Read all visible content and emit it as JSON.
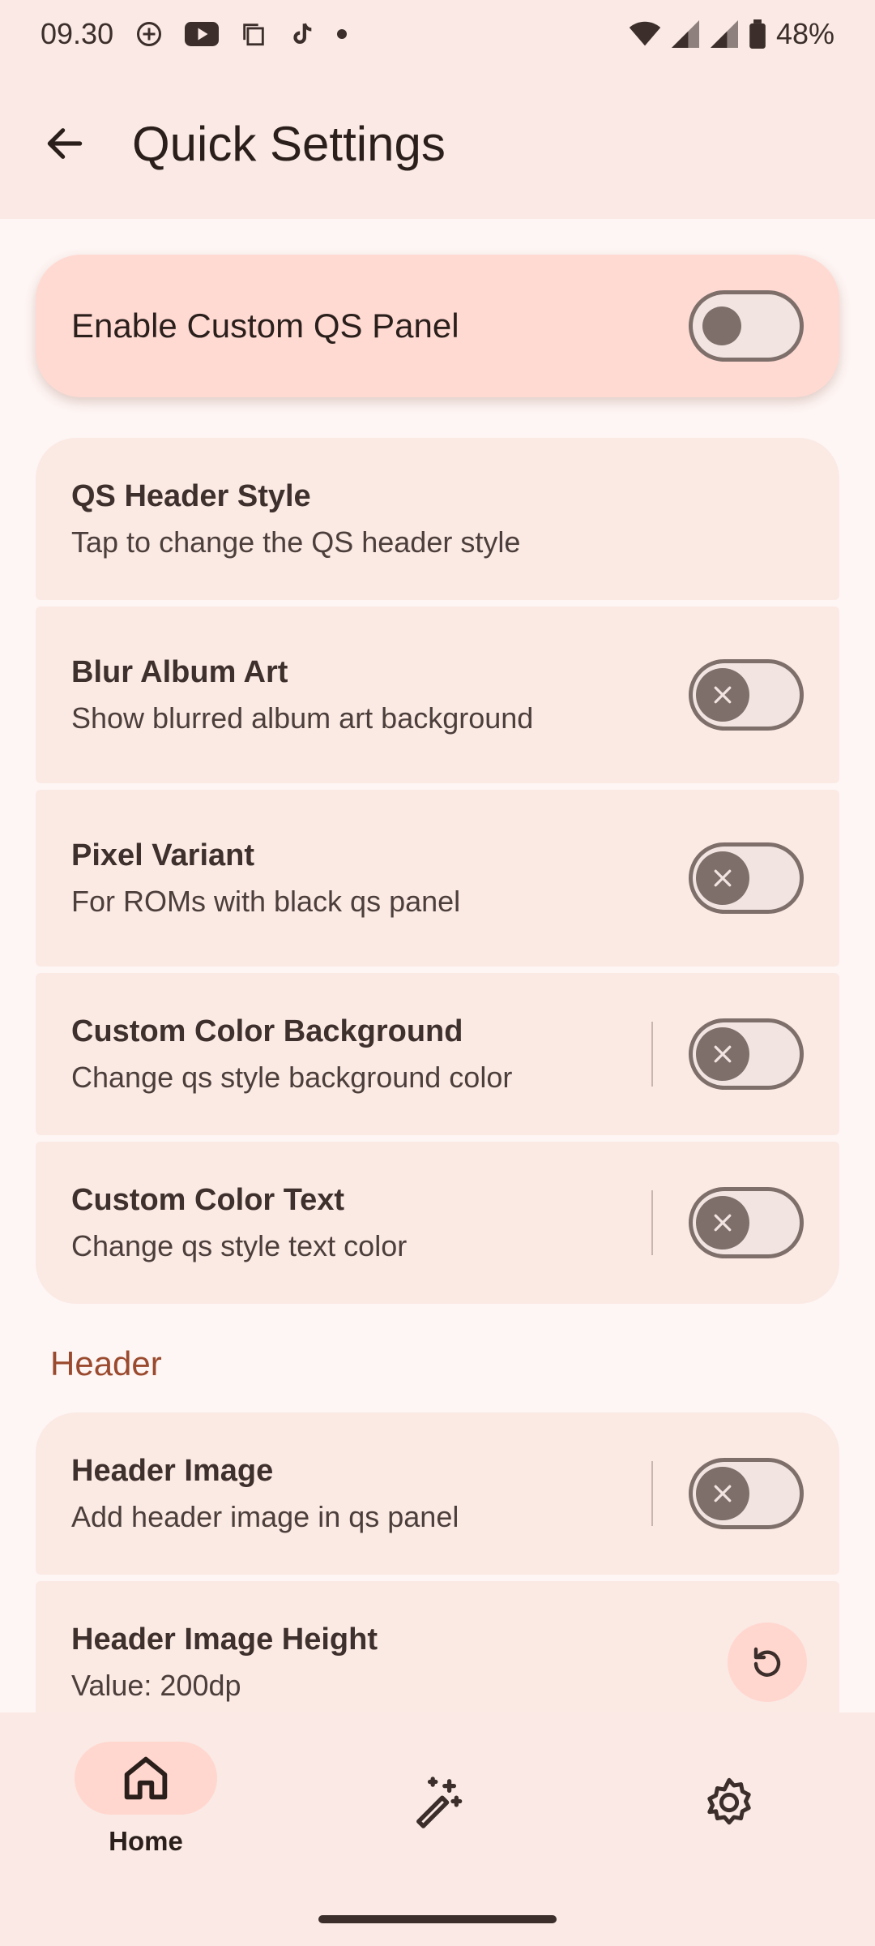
{
  "status_bar": {
    "time": "09.30",
    "battery": "48%",
    "left_icons": [
      "assistant-icon",
      "youtube-icon",
      "copy-icon",
      "tiktok-icon",
      "dot-icon"
    ],
    "right_icons": [
      "wifi-icon",
      "signal-icon",
      "signal-icon",
      "battery-icon"
    ]
  },
  "app_bar": {
    "title": "Quick Settings",
    "back_icon": "arrow-back-icon"
  },
  "hero": {
    "label": "Enable Custom QS Panel",
    "enabled": false
  },
  "items": [
    {
      "title": "QS Header Style",
      "subtitle": "Tap to change the QS header style"
    },
    {
      "title": "Blur Album Art",
      "subtitle": "Show blurred album art background",
      "enabled": false
    },
    {
      "title": "Pixel Variant",
      "subtitle": "For ROMs with black qs panel",
      "enabled": false
    },
    {
      "title": "Custom Color Background",
      "subtitle": "Change qs style background color",
      "enabled": false
    },
    {
      "title": "Custom Color Text",
      "subtitle": "Change qs style text color",
      "enabled": false
    }
  ],
  "header_section": {
    "label": "Header",
    "items": [
      {
        "title": "Header Image",
        "subtitle": "Add header image in qs panel",
        "enabled": false
      },
      {
        "title": "Header Image Height",
        "subtitle": "Value: 200dp",
        "reset_icon": "reset-icon"
      }
    ]
  },
  "bottom_nav": {
    "items": [
      {
        "label": "Home",
        "icon": "home-icon",
        "active": true
      },
      {
        "label": "",
        "icon": "magic-wand-icon",
        "active": false
      },
      {
        "label": "",
        "icon": "gear-icon",
        "active": false
      }
    ]
  },
  "colors": {
    "background": "#FEF6F4",
    "bar": "#FAE9E4",
    "card": "#FBE9E4",
    "hero": "#FFDAD3",
    "accent": "#9A4A2E"
  }
}
